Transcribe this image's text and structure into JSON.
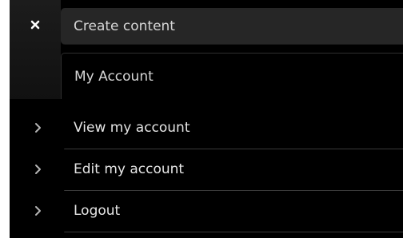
{
  "toolbar": {
    "close_icon": "close-icon",
    "create_content_label": "Create content",
    "my_account_label": "My Account"
  },
  "menu": {
    "items": [
      {
        "label": "View my account",
        "icon": "chevron-right-icon"
      },
      {
        "label": "Edit my account",
        "icon": "chevron-right-icon"
      },
      {
        "label": "Logout",
        "icon": "chevron-right-icon"
      }
    ]
  },
  "colors": {
    "background": "#000000",
    "tab_active": "#262626",
    "text": "#e6e6e6",
    "divider": "#3a3a3a"
  }
}
